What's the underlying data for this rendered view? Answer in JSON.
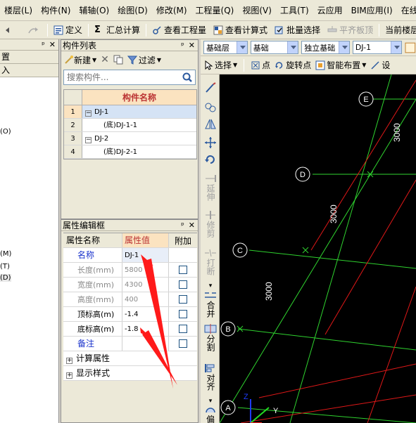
{
  "menu": [
    "楼层(L)",
    "构件(N)",
    "辅轴(O)",
    "绘图(D)",
    "修改(M)",
    "工程量(Q)",
    "视图(V)",
    "工具(T)",
    "云应用",
    "BIM应用(I)",
    "在线服务"
  ],
  "toolbar": {
    "define": "定义",
    "sum_calc": "汇总计算",
    "view_quantity": "查看工程量",
    "view_formula": "查看计算式",
    "batch_select": "批量选择",
    "flatten_slab": "平齐板顶",
    "current_floor": "当前楼层"
  },
  "left_panel": {
    "row1": "置",
    "row2": "入",
    "items": [
      "(O)",
      "(M)",
      "(T)",
      "(D)"
    ]
  },
  "component_list": {
    "title": "构件列表",
    "new_label": "新建",
    "filter_label": "过滤",
    "search_placeholder": "搜索构件...",
    "column_header": "构件名称",
    "rows": [
      {
        "num": "1",
        "name": "DJ-1"
      },
      {
        "num": "2",
        "name": "(底)DJ-1-1"
      },
      {
        "num": "3",
        "name": "DJ-2"
      },
      {
        "num": "4",
        "name": "(底)DJ-2-1"
      }
    ]
  },
  "property_panel": {
    "title": "属性编辑框",
    "headers": {
      "name": "属性名称",
      "value": "属性值",
      "extra": "附加"
    },
    "rows": [
      {
        "name": "名称",
        "value": "DJ-1"
      },
      {
        "name": "长度(mm)",
        "value": "5800"
      },
      {
        "name": "宽度(mm)",
        "value": "4300"
      },
      {
        "name": "高度(mm)",
        "value": "400"
      },
      {
        "name": "顶标高(m)",
        "value": "-1.4"
      },
      {
        "name": "底标高(m)",
        "value": "-1.8"
      },
      {
        "name": "备注",
        "value": ""
      }
    ],
    "groups": [
      "计算属性",
      "显示样式"
    ]
  },
  "draw_toolbar": {
    "layer_type": "基础层",
    "category": "基础",
    "element_type": "独立基础",
    "element": "DJ-1",
    "select_label": "选择",
    "point_label": "点",
    "rotate_point_label": "旋转点",
    "smart_layout_label": "智能布置",
    "set_label": "设"
  },
  "vertical_tools": {
    "extend": "延伸",
    "trim": "修剪",
    "break": "打断",
    "merge": "合并",
    "split": "分割",
    "align": "对齐",
    "offset": "偏"
  },
  "canvas": {
    "axis_labels": [
      "E",
      "D",
      "C",
      "B",
      "A"
    ],
    "dimensions": [
      "3000",
      "3000",
      "3000"
    ],
    "ucs": {
      "z": "Z",
      "y": "Y"
    }
  },
  "colors": {
    "canvas_bg": "#000000",
    "axis_green": "#2fd32f",
    "axis_red": "#e01818",
    "highlight": "#fbe3c0",
    "annotation_red": "#ff1a1a"
  }
}
